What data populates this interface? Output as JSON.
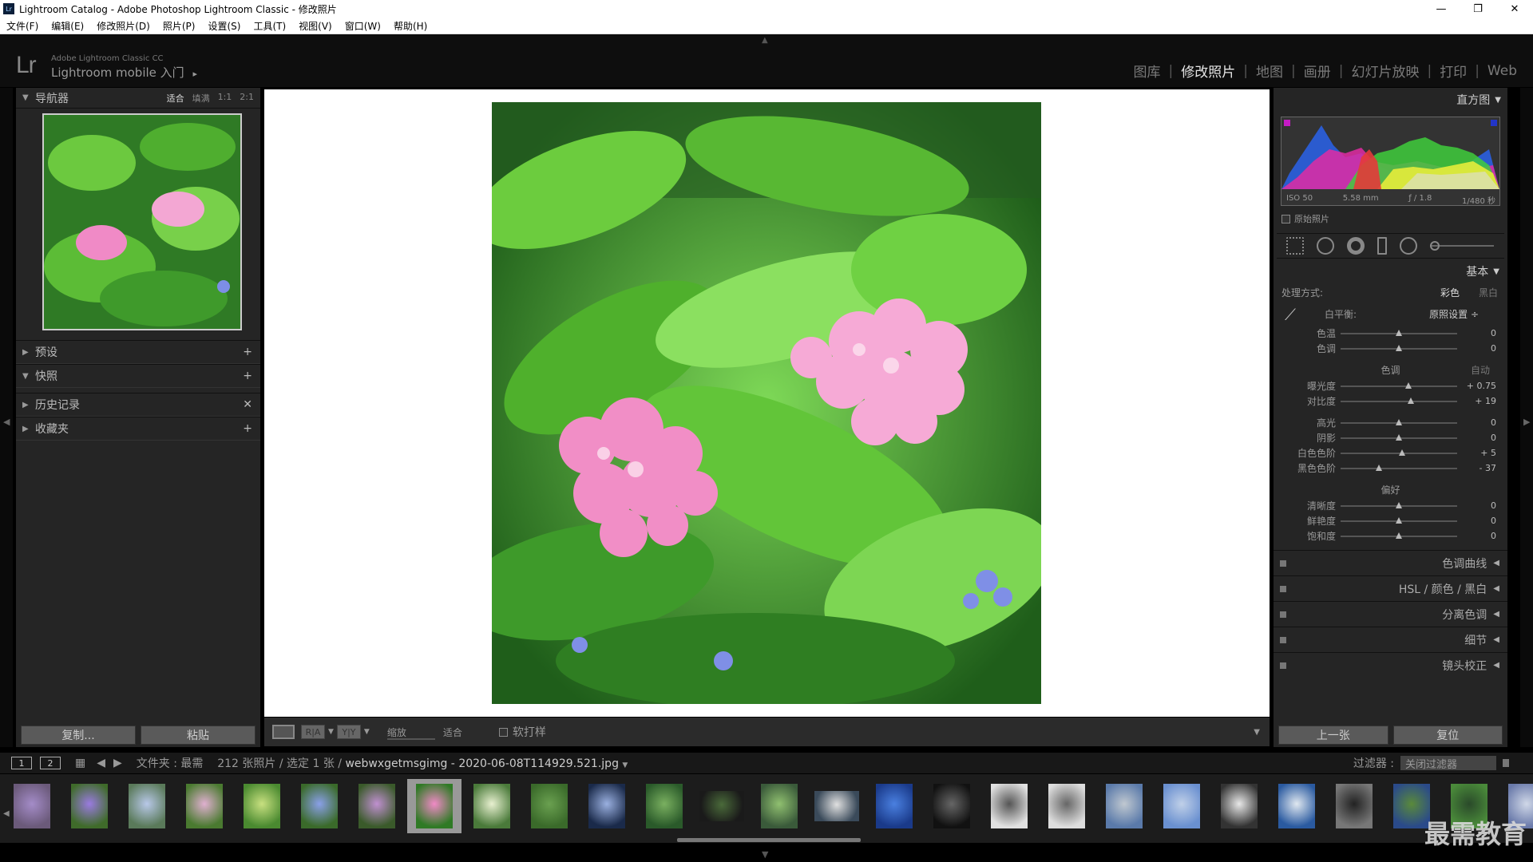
{
  "window": {
    "title": "Lightroom Catalog - Adobe Photoshop Lightroom Classic - 修改照片",
    "minimize": "—",
    "maximize": "❐",
    "close": "✕"
  },
  "menu": [
    "文件(F)",
    "编辑(E)",
    "修改照片(D)",
    "照片(P)",
    "设置(S)",
    "工具(T)",
    "视图(V)",
    "窗口(W)",
    "帮助(H)"
  ],
  "identity": {
    "logo": "Lr",
    "product": "Adobe Lightroom Classic CC",
    "mobile": "Lightroom mobile 入门",
    "arrow": "▸"
  },
  "modules": [
    {
      "label": "图库",
      "active": false
    },
    {
      "label": "修改照片",
      "active": true
    },
    {
      "label": "地图",
      "active": false
    },
    {
      "label": "画册",
      "active": false
    },
    {
      "label": "幻灯片放映",
      "active": false
    },
    {
      "label": "打印",
      "active": false
    },
    {
      "label": "Web",
      "active": false
    }
  ],
  "navigator": {
    "title": "导航器",
    "zoom_fit": "适合",
    "zoom_fill": "填满",
    "zoom_1": "1:1",
    "zoom_2": "2:1"
  },
  "left_sections": [
    {
      "title": "预设",
      "action": "+"
    },
    {
      "title": "快照",
      "action": "+",
      "open": true
    },
    {
      "title": "历史记录",
      "action": "✕"
    },
    {
      "title": "收藏夹",
      "action": "+"
    }
  ],
  "left_buttons": {
    "copy": "复制...",
    "paste": "粘贴"
  },
  "toolbar": {
    "ra": "R|A",
    "yy": "Y|Y",
    "zoom_label": "缩放",
    "zoom_value": "适合",
    "softproof": "软打样"
  },
  "histogram": {
    "title": "直方图",
    "iso": "ISO 50",
    "focal": "5.58 mm",
    "aperture": "ƒ / 1.8",
    "shutter": "1/480 秒",
    "original": "原始照片"
  },
  "basic": {
    "title": "基本",
    "treatment_label": "处理方式:",
    "color": "彩色",
    "bw": "黑白",
    "wb_label": "白平衡:",
    "wb_value": "原照设置 ÷",
    "tone_title": "色调",
    "auto": "自动",
    "presence_title": "偏好",
    "sliders": [
      {
        "label": "色温",
        "value": "0",
        "pos": 0.5
      },
      {
        "label": "色调",
        "value": "0",
        "pos": 0.5
      },
      {
        "label": "曝光度",
        "value": "+ 0.75",
        "pos": 0.58
      },
      {
        "label": "对比度",
        "value": "+ 19",
        "pos": 0.6
      },
      {
        "label": "高光",
        "value": "0",
        "pos": 0.5
      },
      {
        "label": "阴影",
        "value": "0",
        "pos": 0.5
      },
      {
        "label": "白色色阶",
        "value": "+ 5",
        "pos": 0.53
      },
      {
        "label": "黑色色阶",
        "value": "- 37",
        "pos": 0.33
      },
      {
        "label": "清晰度",
        "value": "0",
        "pos": 0.5
      },
      {
        "label": "鲜艳度",
        "value": "0",
        "pos": 0.5
      },
      {
        "label": "饱和度",
        "value": "0",
        "pos": 0.5
      }
    ]
  },
  "right_sections": [
    "色调曲线",
    "HSL  /  颜色  /  黑白",
    "分离色调",
    "细节",
    "镜头校正"
  ],
  "right_buttons": {
    "prev": "上一张",
    "reset": "复位"
  },
  "filmstrip": {
    "page1": "1",
    "page2": "2",
    "source": "文件夹 : 最需",
    "count": "212 张照片 / 选定 1 张 /",
    "filename": "webwxgetmsgimg - 2020-06-08T114929.521.jpg",
    "filter_label": "过滤器 :",
    "filter_value": "关闭过滤器"
  },
  "watermark": "最需教育"
}
